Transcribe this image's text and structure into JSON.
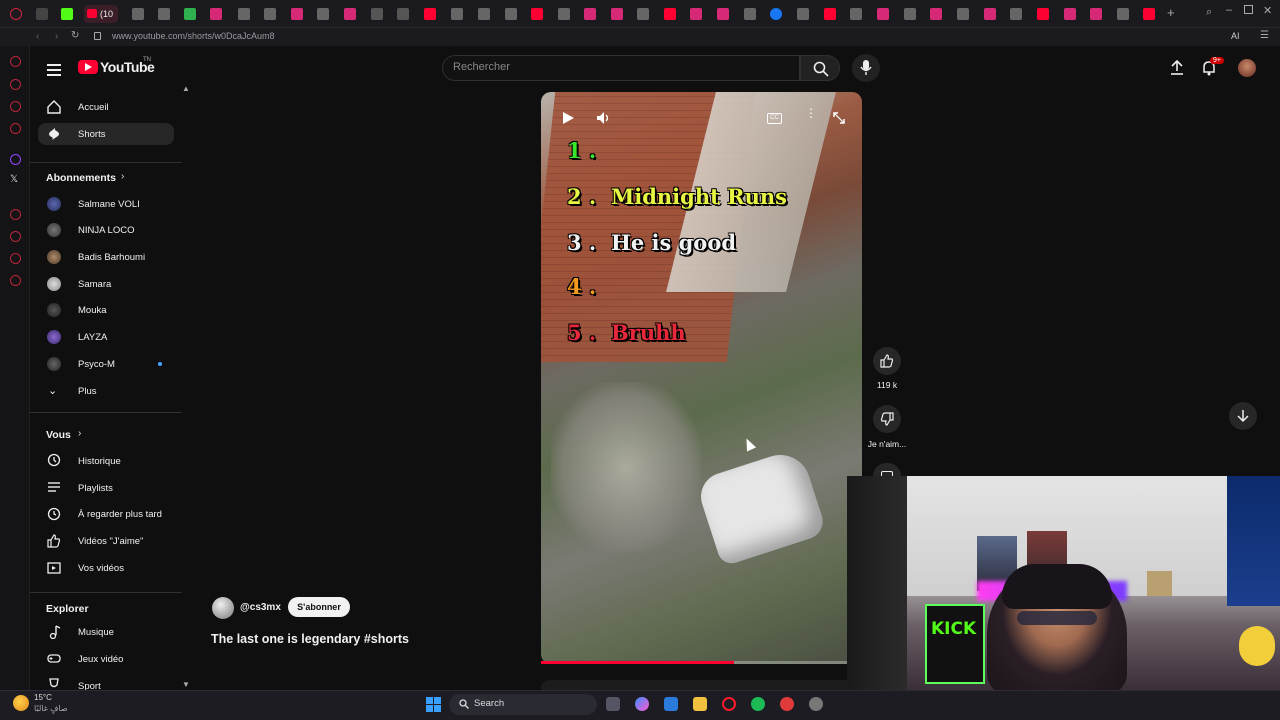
{
  "browser": {
    "active_tab_label": "(10",
    "url": "www.youtube.com/shorts/w0DcaJcAum8",
    "extension_badge": "AI"
  },
  "header": {
    "logo_text": "YouTube",
    "logo_region": "TN",
    "search_placeholder": "Rechercher",
    "notification_count": "9+"
  },
  "sidebar": {
    "main": [
      {
        "label": "Accueil",
        "icon": "home-icon"
      },
      {
        "label": "Shorts",
        "icon": "shorts-icon",
        "active": true
      }
    ],
    "subscriptions_title": "Abonnements",
    "subscriptions": [
      {
        "label": "Salmane VOLI"
      },
      {
        "label": "NINJA LOCO"
      },
      {
        "label": "Badis Barhoumi"
      },
      {
        "label": "Samara"
      },
      {
        "label": "Mouka"
      },
      {
        "label": "LAYZA"
      },
      {
        "label": "Psyco-M",
        "live_dot": true
      }
    ],
    "more_label": "Plus",
    "you_title": "Vous",
    "you": [
      {
        "label": "Historique",
        "icon": "history-icon"
      },
      {
        "label": "Playlists",
        "icon": "playlist-icon"
      },
      {
        "label": "À regarder plus tard",
        "icon": "clock-icon"
      },
      {
        "label": "Vidéos \"J'aime\"",
        "icon": "thumb-up-icon"
      },
      {
        "label": "Vos vidéos",
        "icon": "video-icon"
      }
    ],
    "explore_title": "Explorer",
    "explore": [
      {
        "label": "Musique",
        "icon": "music-icon"
      },
      {
        "label": "Jeux vidéo",
        "icon": "gamepad-icon"
      },
      {
        "label": "Sport",
        "icon": "trophy-icon"
      }
    ]
  },
  "video": {
    "overlay_lines": [
      {
        "num": "1 .",
        "text": "",
        "color": "#39e62c"
      },
      {
        "num": "2 .",
        "text": "Midnight Runs",
        "color": "#e8f542"
      },
      {
        "num": "3 .",
        "text": "He is good",
        "color": "#f2f2f2"
      },
      {
        "num": "4 .",
        "text": "",
        "color": "#f39a1e"
      },
      {
        "num": "5 .",
        "text": "Bruhh",
        "color": "#e6283a"
      }
    ],
    "progress_fraction": 0.6
  },
  "actions": {
    "likes": "119 k",
    "dislike_label": "Je n'aim..."
  },
  "channel": {
    "handle": "@cs3mx",
    "subscribe_label": "S'abonner",
    "video_title": "The last one is legendary #shorts"
  },
  "webcam": {
    "sign_text": "KICK"
  },
  "taskbar": {
    "search_label": "Search",
    "weather_temp": "15°C",
    "weather_desc": "صافٍ غالبًا"
  }
}
